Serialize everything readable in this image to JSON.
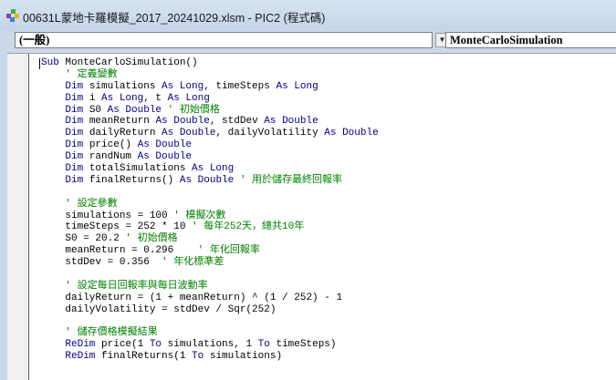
{
  "window": {
    "title": "00631L蒙地卡羅模擬_2017_20241029.xlsm - PIC2 (程式碼)",
    "icon": "vba-project-icon"
  },
  "object_combo": {
    "value": "(一般)"
  },
  "procedure_combo": {
    "value": "MonteCarloSimulation"
  },
  "colors": {
    "keyword": "#00008b",
    "comment": "#008000",
    "text": "#000000"
  },
  "code_lines": [
    [
      [
        "kw",
        "Sub "
      ],
      [
        "tx",
        "MonteCarloSimulation()"
      ]
    ],
    [
      [
        "tx",
        "    "
      ],
      [
        "cm",
        "' 定義變數"
      ]
    ],
    [
      [
        "tx",
        "    "
      ],
      [
        "kw",
        "Dim "
      ],
      [
        "tx",
        "simulations "
      ],
      [
        "kw",
        "As Long"
      ],
      [
        "tx",
        ", timeSteps "
      ],
      [
        "kw",
        "As Long"
      ]
    ],
    [
      [
        "tx",
        "    "
      ],
      [
        "kw",
        "Dim "
      ],
      [
        "tx",
        "i "
      ],
      [
        "kw",
        "As Long"
      ],
      [
        "tx",
        ", t "
      ],
      [
        "kw",
        "As Long"
      ]
    ],
    [
      [
        "tx",
        "    "
      ],
      [
        "kw",
        "Dim "
      ],
      [
        "tx",
        "S0 "
      ],
      [
        "kw",
        "As Double "
      ],
      [
        "cm",
        "' 初始價格"
      ]
    ],
    [
      [
        "tx",
        "    "
      ],
      [
        "kw",
        "Dim "
      ],
      [
        "tx",
        "meanReturn "
      ],
      [
        "kw",
        "As Double"
      ],
      [
        "tx",
        ", stdDev "
      ],
      [
        "kw",
        "As Double"
      ]
    ],
    [
      [
        "tx",
        "    "
      ],
      [
        "kw",
        "Dim "
      ],
      [
        "tx",
        "dailyReturn "
      ],
      [
        "kw",
        "As Double"
      ],
      [
        "tx",
        ", dailyVolatility "
      ],
      [
        "kw",
        "As Double"
      ]
    ],
    [
      [
        "tx",
        "    "
      ],
      [
        "kw",
        "Dim "
      ],
      [
        "tx",
        "price() "
      ],
      [
        "kw",
        "As Double"
      ]
    ],
    [
      [
        "tx",
        "    "
      ],
      [
        "kw",
        "Dim "
      ],
      [
        "tx",
        "randNum "
      ],
      [
        "kw",
        "As Double"
      ]
    ],
    [
      [
        "tx",
        "    "
      ],
      [
        "kw",
        "Dim "
      ],
      [
        "tx",
        "totalSimulations "
      ],
      [
        "kw",
        "As Long"
      ]
    ],
    [
      [
        "tx",
        "    "
      ],
      [
        "kw",
        "Dim "
      ],
      [
        "tx",
        "finalReturns() "
      ],
      [
        "kw",
        "As Double "
      ],
      [
        "cm",
        "' 用於儲存最終回報率"
      ]
    ],
    [],
    [
      [
        "tx",
        "    "
      ],
      [
        "cm",
        "' 設定參數"
      ]
    ],
    [
      [
        "tx",
        "    simulations = 100 "
      ],
      [
        "cm",
        "' 模擬次數"
      ]
    ],
    [
      [
        "tx",
        "    timeSteps = 252 * 10 "
      ],
      [
        "cm",
        "' 每年252天，總共10年"
      ]
    ],
    [
      [
        "tx",
        "    S0 = 20.2 "
      ],
      [
        "cm",
        "' 初始價格"
      ]
    ],
    [
      [
        "tx",
        "    meanReturn = 0.296    "
      ],
      [
        "cm",
        "' 年化回報率"
      ]
    ],
    [
      [
        "tx",
        "    stdDev = 0.356  "
      ],
      [
        "cm",
        "' 年化標準差"
      ]
    ],
    [],
    [
      [
        "tx",
        "    "
      ],
      [
        "cm",
        "' 設定每日回報率與每日波動率"
      ]
    ],
    [
      [
        "tx",
        "    dailyReturn = (1 + meanReturn) ^ (1 / 252) - 1"
      ]
    ],
    [
      [
        "tx",
        "    dailyVolatility = stdDev / Sqr(252)"
      ]
    ],
    [],
    [
      [
        "tx",
        "    "
      ],
      [
        "cm",
        "' 儲存價格模擬結果"
      ]
    ],
    [
      [
        "tx",
        "    "
      ],
      [
        "kw",
        "ReDim "
      ],
      [
        "tx",
        "price(1 "
      ],
      [
        "kw",
        "To "
      ],
      [
        "tx",
        "simulations, 1 "
      ],
      [
        "kw",
        "To "
      ],
      [
        "tx",
        "timeSteps)"
      ]
    ],
    [
      [
        "tx",
        "    "
      ],
      [
        "kw",
        "ReDim "
      ],
      [
        "tx",
        "finalReturns(1 "
      ],
      [
        "kw",
        "To "
      ],
      [
        "tx",
        "simulations)"
      ]
    ]
  ]
}
